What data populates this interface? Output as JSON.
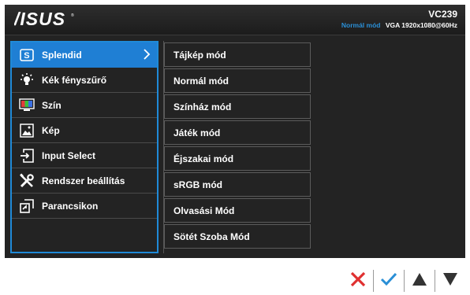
{
  "header": {
    "brand": "ASUS",
    "model": "VC239",
    "mode": "Normál mód",
    "signal": "VGA  1920x1080@60Hz"
  },
  "menu": {
    "items": [
      {
        "label": "Splendid",
        "icon": "splendid-s-icon",
        "active": true
      },
      {
        "label": "Kék fényszűrő",
        "icon": "bulb-icon"
      },
      {
        "label": "Szín",
        "icon": "color-monitor-icon"
      },
      {
        "label": "Kép",
        "icon": "image-icon"
      },
      {
        "label": "Input Select",
        "icon": "input-select-icon"
      },
      {
        "label": "Rendszer beállítás",
        "icon": "tools-icon"
      },
      {
        "label": "Parancsikon",
        "icon": "shortcut-icon"
      }
    ]
  },
  "submenu": {
    "items": [
      "Tájkép mód",
      "Normál mód",
      "Színház mód",
      "Játék mód",
      "Éjszakai mód",
      "sRGB mód",
      "Olvasási Mód",
      "Sötét Szoba Mód"
    ]
  },
  "keys": {
    "icons": [
      "close-x-icon",
      "check-icon",
      "up-triangle-icon",
      "down-triangle-icon"
    ],
    "colors": {
      "close": "#e03030",
      "check": "#2a8fd6",
      "arrow": "#333333",
      "accent": "#1f7fd4"
    }
  }
}
